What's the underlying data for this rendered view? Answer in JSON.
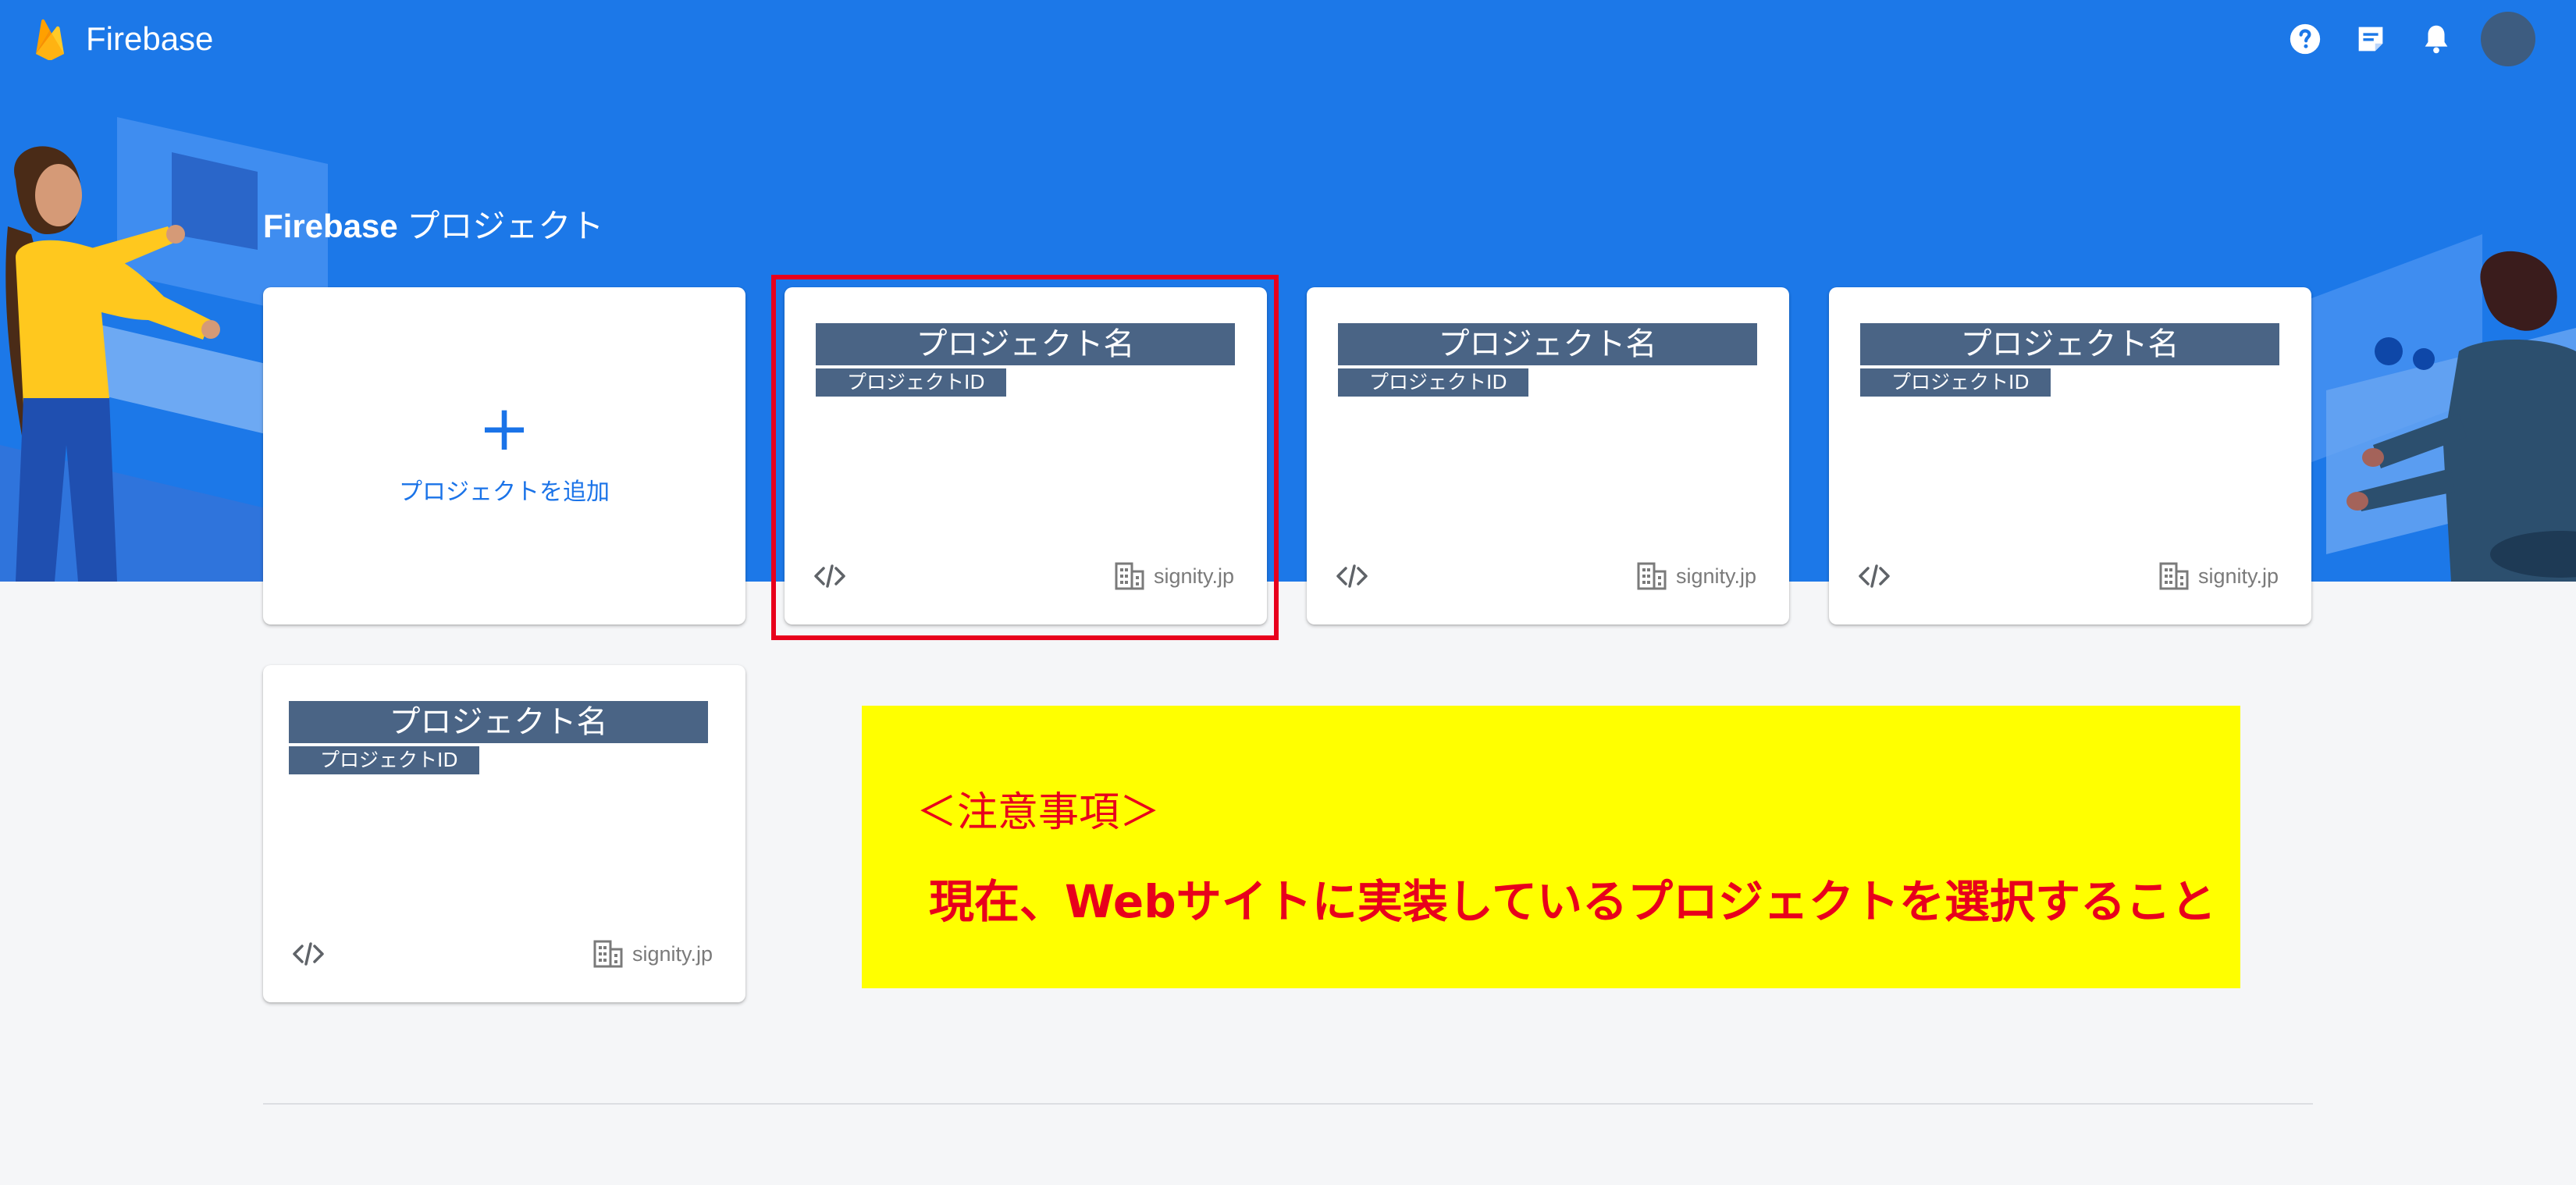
{
  "app": {
    "name": "Firebase"
  },
  "header": {
    "icons": [
      "help-icon",
      "release-notes-icon",
      "notifications-icon",
      "account-avatar"
    ]
  },
  "section": {
    "title_bold": "Firebase",
    "title_rest": " プロジェクト"
  },
  "add_project": {
    "plus": "+",
    "label": "プロジェクトを追加"
  },
  "projects": [
    {
      "name": "プロジェクト名",
      "id": "プロジェクトID",
      "org": "signity.jp",
      "selected": true
    },
    {
      "name": "プロジェクト名",
      "id": "プロジェクトID",
      "org": "signity.jp",
      "selected": false
    },
    {
      "name": "プロジェクト名",
      "id": "プロジェクトID",
      "org": "signity.jp",
      "selected": false
    },
    {
      "name": "プロジェクト名",
      "id": "プロジェクトID",
      "org": "signity.jp",
      "selected": false
    }
  ],
  "notice": {
    "title": "＜注意事項＞",
    "body": "現在、Webサイトに実装しているプロジェクトを選択すること"
  },
  "colors": {
    "brand_blue": "#1c78e8",
    "link_blue": "#1a73e8",
    "mask_slate": "#4a6485",
    "highlight_red": "#e8001c",
    "notice_yellow": "#ffff00"
  }
}
